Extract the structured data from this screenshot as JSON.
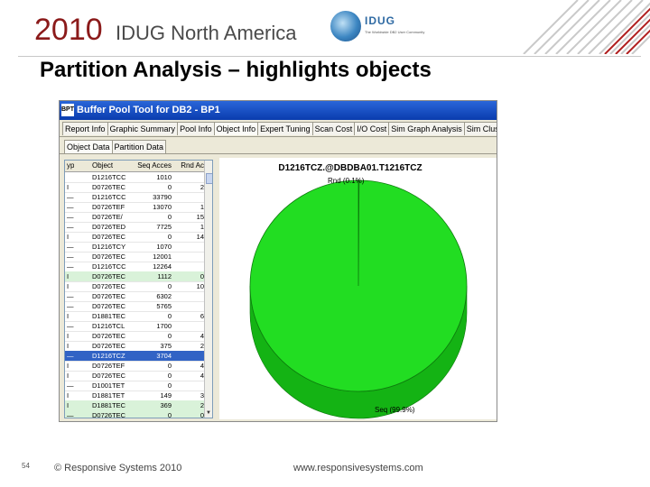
{
  "header": {
    "year": "2010",
    "conference": "IDUG North America",
    "logo_text": "IDUG",
    "logo_tagline": "The Worldwide DB2 User Community"
  },
  "slide": {
    "title": "Partition Analysis – highlights objects",
    "number": "54",
    "copyright": "© Responsive Systems 2010",
    "website": "www.responsivesystems.com"
  },
  "window": {
    "title": "Buffer Pool Tool for DB2 - BP1",
    "icon_text": "BPT",
    "tabs": [
      {
        "label": "Report Info",
        "active": false
      },
      {
        "label": "Graphic Summary",
        "active": false
      },
      {
        "label": "Pool Info",
        "active": false
      },
      {
        "label": "Object Info",
        "active": true
      },
      {
        "label": "Expert Tuning",
        "active": false
      },
      {
        "label": "Scan Cost",
        "active": false
      },
      {
        "label": "I/O Cost",
        "active": false
      },
      {
        "label": "Sim Graph Analysis",
        "active": false
      },
      {
        "label": "Sim Clus",
        "active": false
      }
    ],
    "subtabs": [
      {
        "label": "Object Data",
        "active": true
      },
      {
        "label": "Partition Data",
        "active": false
      }
    ]
  },
  "grid": {
    "headers": [
      "ype",
      "Object",
      "Seq Acces",
      "Rnd Ac"
    ],
    "rows": [
      {
        "type": "",
        "object": "D1216TCC",
        "seq": "1010",
        "rnd": "",
        "state": "normal"
      },
      {
        "type": "I",
        "object": "D0726TEC",
        "seq": "0",
        "rnd": "2",
        "state": "normal"
      },
      {
        "type": "—",
        "object": "D1216TCC",
        "seq": "33790",
        "rnd": "",
        "state": "normal"
      },
      {
        "type": "—",
        "object": "D0726TEF",
        "seq": "13070",
        "rnd": "1",
        "state": "normal"
      },
      {
        "type": "—",
        "object": "D0726TE/",
        "seq": "0",
        "rnd": "15",
        "state": "normal"
      },
      {
        "type": "—",
        "object": "D0726TED",
        "seq": "7725",
        "rnd": "1",
        "state": "normal"
      },
      {
        "type": "I",
        "object": "D0726TEC",
        "seq": "0",
        "rnd": "14",
        "state": "normal"
      },
      {
        "type": "—",
        "object": "D1216TCY",
        "seq": "1070",
        "rnd": "",
        "state": "normal"
      },
      {
        "type": "—",
        "object": "D0726TEC",
        "seq": "12001",
        "rnd": "",
        "state": "normal"
      },
      {
        "type": "—",
        "object": "D1216TCC",
        "seq": "12264",
        "rnd": "",
        "state": "normal"
      },
      {
        "type": "I",
        "object": "D0726TEC",
        "seq": "1112",
        "rnd": "0",
        "state": "hl"
      },
      {
        "type": "I",
        "object": "D0726TEC",
        "seq": "0",
        "rnd": "10",
        "state": "normal"
      },
      {
        "type": "—",
        "object": "D0726TEC",
        "seq": "6302",
        "rnd": "",
        "state": "normal"
      },
      {
        "type": "—",
        "object": "D0726TEC",
        "seq": "5765",
        "rnd": "",
        "state": "normal"
      },
      {
        "type": "I",
        "object": "D1881TEC",
        "seq": "0",
        "rnd": "6",
        "state": "normal"
      },
      {
        "type": "—",
        "object": "D1216TCL",
        "seq": "1700",
        "rnd": "",
        "state": "normal"
      },
      {
        "type": "I",
        "object": "D0726TEC",
        "seq": "0",
        "rnd": "4",
        "state": "normal"
      },
      {
        "type": "I",
        "object": "D0726TEC",
        "seq": "375",
        "rnd": "2",
        "state": "normal"
      },
      {
        "type": "—",
        "object": "D1216TCZ",
        "seq": "3704",
        "rnd": "",
        "state": "sel"
      },
      {
        "type": "I",
        "object": "D0726TEF",
        "seq": "0",
        "rnd": "4",
        "state": "normal"
      },
      {
        "type": "I",
        "object": "D0726TEC",
        "seq": "0",
        "rnd": "4",
        "state": "normal"
      },
      {
        "type": "—",
        "object": "D1001TET",
        "seq": "0",
        "rnd": "",
        "state": "normal"
      },
      {
        "type": "I",
        "object": "D1881TET",
        "seq": "149",
        "rnd": "3",
        "state": "normal"
      },
      {
        "type": "I",
        "object": "D1881TEC",
        "seq": "369",
        "rnd": "2",
        "state": "hl"
      },
      {
        "type": "—",
        "object": "D0726TEC",
        "seq": "0",
        "rnd": "0",
        "state": "hl"
      }
    ],
    "scroll_down_glyph": "▼"
  },
  "chart_data": {
    "type": "pie",
    "title": "D1216TCZ.@DBDBA01.T1216TCZ",
    "slices": [
      {
        "label": "Rnd (0.1%)",
        "value": 0.1,
        "color": "#1f7a1f"
      },
      {
        "label": "Seq (99.9%)",
        "value": 99.9,
        "color": "#22dd22"
      }
    ],
    "style": "3d",
    "legend": "none"
  },
  "colors": {
    "pie_top": "#22dd22",
    "pie_side": "#14b314",
    "selected_row": "#3163c5",
    "highlight_row": "#d9f2d9",
    "year_red": "#8b1a1a"
  }
}
